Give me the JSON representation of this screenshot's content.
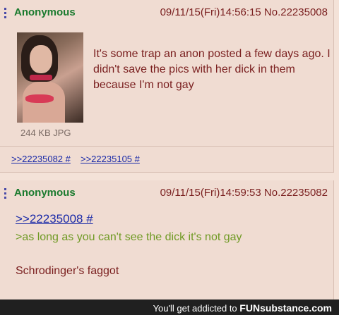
{
  "posts": [
    {
      "name": "Anonymous",
      "datetime": "09/11/15(Fri)14:56:15",
      "post_no": "No.22235008",
      "file_info": "244 KB JPG",
      "body": "It's some trap an anon posted a few days ago. I didn't save the pics with her dick in them because I'm not gay",
      "replies": [
        ">>22235082 #",
        ">>22235105 #"
      ]
    },
    {
      "name": "Anonymous",
      "datetime": "09/11/15(Fri)14:59:53",
      "post_no": "No.22235082",
      "quote_link": ">>22235008 #",
      "greentext": ">as long as you can't see the dick it's not gay",
      "body": "Schrodinger's faggot"
    }
  ],
  "footer": {
    "text": "You'll get addicted to",
    "brand": "FUNsubstance.com"
  },
  "colors": {
    "post_bg": "#f0dcd2",
    "name": "#1a7a2e",
    "text": "#7a1f1f",
    "link": "#1a2aa8",
    "greentext": "#6f9a24"
  }
}
